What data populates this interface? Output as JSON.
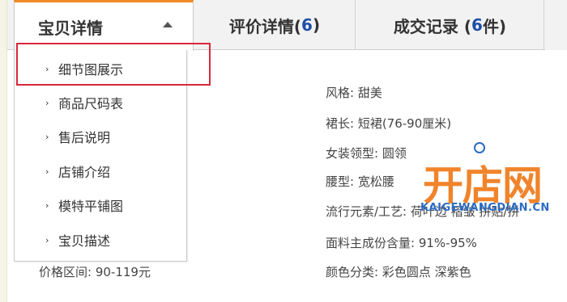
{
  "tabs": {
    "details": {
      "label": "宝贝详情"
    },
    "reviews": {
      "label": "评价详情(",
      "count": "6",
      "suffix": ")"
    },
    "records": {
      "label": "成交记录 (",
      "count": "6",
      "suffix": "件)"
    }
  },
  "menu": {
    "bullet": "›",
    "items": [
      {
        "label": "细节图展示"
      },
      {
        "label": "商品尺码表"
      },
      {
        "label": "售后说明"
      },
      {
        "label": "店铺介绍"
      },
      {
        "label": "模特平铺图"
      },
      {
        "label": "宝贝描述"
      }
    ]
  },
  "attributes": [
    "风格: 甜美",
    "裙长: 短裙(76-90厘米)",
    "女装领型: 圆领",
    "腰型: 宽松腰",
    "流行元素/工艺: 荷叶边 褶皱 拼贴/拼",
    "面料主成份含量: 91%-95%",
    "颜色分类: 彩色圆点 深紫色"
  ],
  "price_range": "价格区间: 90-119元",
  "watermark": {
    "logo_text": "开店网",
    "url_text": "KAIGEWANGDIAN.CN"
  },
  "colors": {
    "accent_orange": "#f08a24",
    "highlight_red": "#d8283a",
    "link_blue": "#1d4fa8"
  }
}
